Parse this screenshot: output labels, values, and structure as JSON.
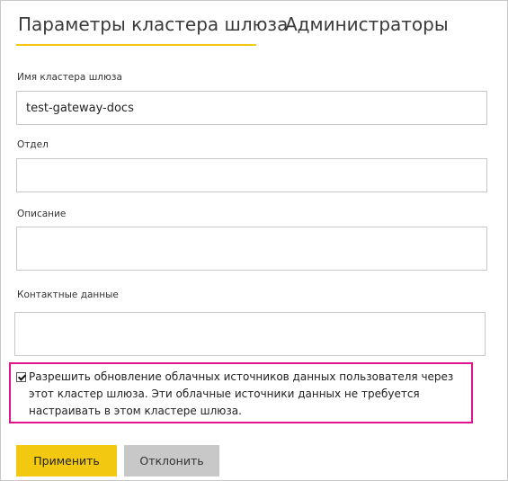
{
  "tabs": {
    "active_label": "Параметры кластера шлюза",
    "inactive_label": "Администраторы"
  },
  "form": {
    "cluster_name": {
      "label": "Имя кластера шлюза",
      "value": "test-gateway-docs"
    },
    "department": {
      "label": "Отдел",
      "value": ""
    },
    "description": {
      "label": "Описание",
      "value": ""
    },
    "contact": {
      "label": "Контактные данные",
      "value": ""
    },
    "allow_cloud": {
      "checked": true,
      "label": "Разрешить обновление облачных источников данных пользователя через этот кластер шлюза. Эти облачные источники данных не требуется настраивать в этом кластере шлюза."
    }
  },
  "buttons": {
    "apply_label": "Применить",
    "reject_label": "Отклонить"
  },
  "colors": {
    "accent": "#f2c811",
    "highlight_border": "#e0148c",
    "secondary_button": "#c8c8c8"
  }
}
